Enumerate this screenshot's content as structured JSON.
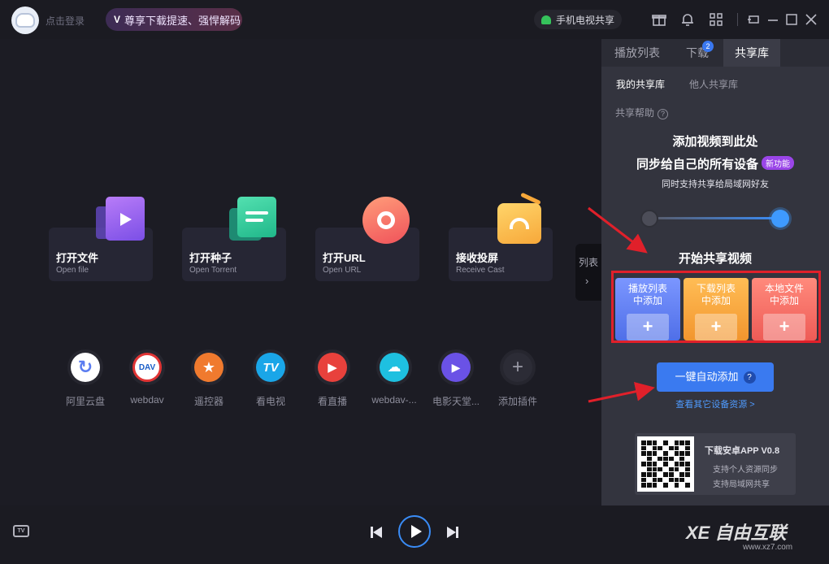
{
  "topbar": {
    "login_text": "点击登录",
    "vip_badge": "V",
    "vip_text": "尊享下载提速、强悍解码",
    "phone_share": "手机电视共享",
    "icons": [
      "gift-icon",
      "bell-icon",
      "apps-grid-icon",
      "mini-mode-icon",
      "minimize-icon",
      "maximize-icon",
      "close-icon"
    ]
  },
  "main": {
    "cards": [
      {
        "title": "打开文件",
        "subtitle": "Open file",
        "icon": "video-file-icon"
      },
      {
        "title": "打开种子",
        "subtitle": "Open Torrent",
        "icon": "torrent-file-icon"
      },
      {
        "title": "打开URL",
        "subtitle": "Open URL",
        "icon": "url-icon"
      },
      {
        "title": "接收投屏",
        "subtitle": "Receive Cast",
        "icon": "cast-icon"
      }
    ],
    "apps": [
      {
        "label": "阿里云盘",
        "glyph": "↻",
        "color": "#5a7cf0"
      },
      {
        "label": "webdav",
        "glyph": "DAV",
        "color": "#ffffff"
      },
      {
        "label": "遥控器",
        "glyph": "★",
        "color": "#f07a2e"
      },
      {
        "label": "看电视",
        "glyph": "TV",
        "color": "#1aa6e8"
      },
      {
        "label": "看直播",
        "glyph": "▶",
        "color": "#e8413c"
      },
      {
        "label": "webdav-...",
        "glyph": "☁",
        "color": "#1ec0e0"
      },
      {
        "label": "电影天堂...",
        "glyph": "▶",
        "color": "#6a52e6"
      },
      {
        "label": "添加插件",
        "glyph": "+",
        "color": "#2c2c36"
      }
    ],
    "list_tab": {
      "label": "列表",
      "chevron": "›"
    }
  },
  "panel": {
    "tabs": [
      {
        "label": "播放列表",
        "active": false
      },
      {
        "label": "下载",
        "active": false
      },
      {
        "label": "共享库",
        "active": true
      }
    ],
    "download_badge": "2",
    "subtabs": [
      {
        "label": "我的共享库",
        "active": true
      },
      {
        "label": "他人共享库",
        "active": false
      }
    ],
    "help": "共享帮助",
    "help_q": "?",
    "headline1": "添加视频到此处",
    "headline2": "同步给自己的所有设备",
    "new_tag": "新功能",
    "desc": "同时支持共享给局域网好友",
    "start_share": "开始共享视频",
    "sources": [
      {
        "line1": "播放列表",
        "line2": "中添加",
        "color": "#5878f0"
      },
      {
        "line1": "下载列表",
        "line2": "中添加",
        "color": "#f4a23a"
      },
      {
        "line1": "本地文件",
        "line2": "中添加",
        "color": "#f06a5e"
      }
    ],
    "plus_glyph": "+",
    "auto_add": "一键自动添加",
    "auto_add_q": "?",
    "other_devices": "查看其它设备资源 >",
    "app_promo": {
      "title": "下载安卓APP V0.8",
      "line1": "支持个人资源同步",
      "line2": "支持局域网共享"
    }
  },
  "bottom": {
    "tv_label": "TV",
    "watermark": "XE 自由互联",
    "watermark_url": "www.xz7.com"
  },
  "colors": {
    "accent": "#3a7af0",
    "highlight_box": "#e0202a",
    "panel_bg": "#33343e",
    "main_bg": "#1c1c24"
  }
}
